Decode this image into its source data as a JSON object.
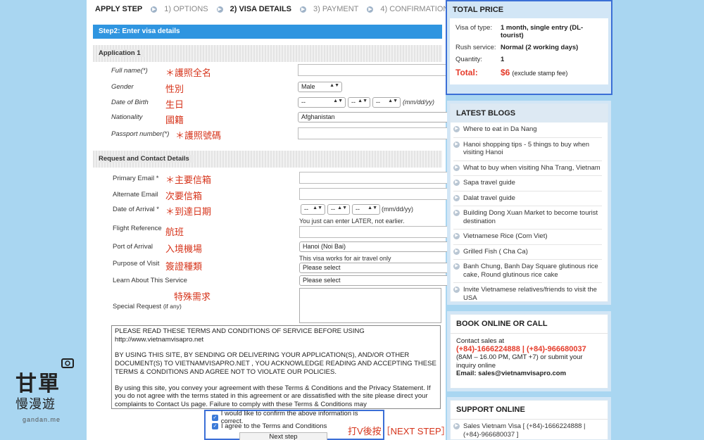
{
  "steps": {
    "label": "APPLY STEP",
    "s1": "1) OPTIONS",
    "s2": "2) VISA DETAILS",
    "s3": "3) PAYMENT",
    "s4": "4) CONFIRMATION"
  },
  "step_bar": "Step2: Enter visa details",
  "application": {
    "header": "Application 1",
    "full_name": "Full name(*)",
    "full_name_cn": "＊護照全名",
    "gender": "Gender",
    "gender_cn": "性別",
    "gender_value": "Male",
    "dob": "Date of Birth",
    "dob_cn": "生日",
    "dob_sel1": "--",
    "dob_sel2": "--",
    "dob_sel3": "--",
    "dob_hint": "(mm/dd/yy)",
    "nationality": "Nationality",
    "nationality_cn": "國籍",
    "nationality_value": "Afghanistan",
    "passport": "Passport number(*)",
    "passport_cn": "＊護照號碼"
  },
  "contact": {
    "header": "Request and Contact Details",
    "primary_email": "Primary Email *",
    "primary_email_cn": "＊主要信箱",
    "alt_email": "Alternate Email",
    "alt_email_cn": "次要信箱",
    "arrival": "Date of Arrival *",
    "arrival_cn": "＊到達日期",
    "arr_sel1": "--",
    "arr_sel2": "--",
    "arr_sel3": "--",
    "arrival_hint": "(mm/dd/yy)",
    "flight_note": "You just can enter LATER, not earlier.",
    "flight": "Flight Reference",
    "flight_cn": "航班",
    "port": "Port of Arrival",
    "port_cn": "入境機場",
    "port_value": "Hanoi (Noi Bai)",
    "port_note": "This visa works for air travel only",
    "purpose": "Purpose of Visit",
    "purpose_cn": "簽證種類",
    "purpose_value": "Please select",
    "learn": "Learn About This Service",
    "learn_value": "Please select",
    "special_cn": "特殊需求",
    "special": "Special Request",
    "special_sub": "(if any)"
  },
  "terms": {
    "p1": "PLEASE READ THESE TERMS AND CONDITIONS OF SERVICE BEFORE USING http://www.vietnamvisapro.net",
    "p2": "BY USING THIS SITE, BY SENDING OR DELIVERING YOUR APPLICATION(S), AND/OR OTHER DOCUMENT(S) TO VIETNAMVISAPRO.NET , YOU ACKNOWLEDGE READING AND ACCEPTING THESE TERMS & CONDITIONS AND AGREE NOT TO VIOLATE OUR POLICIES.",
    "p3": "By using this site, you convey your agreement with these Terms & Conditions and the Privacy Statement. If you do not agree with the terms stated in this agreement or are dissatisfied with the site please direct your complaints to Contact Us page. Failure to comply with these Terms & Conditions may"
  },
  "confirm": {
    "check1": "I would like to confirm the above information is correct.",
    "check2": "I agree to the Terms and Conditions",
    "next": "Next step",
    "annotation": "打V後按［NEXT STEP］"
  },
  "price": {
    "title": "TOTAL PRICE",
    "visa_type_k": "Visa of type:",
    "visa_type_v": "1 month, single entry (DL-tourist)",
    "rush_k": "Rush service:",
    "rush_v": "Normal (2 working days)",
    "qty_k": "Quantity:",
    "qty_v": "1",
    "total_k": "Total:",
    "total_v": "$6",
    "total_note": "(exclude stamp fee)"
  },
  "blogs": {
    "title": "LATEST BLOGS",
    "items": [
      "Where to eat in Da Nang",
      "Hanoi shopping tips - 5 things to buy when visiting Hanoi",
      "What to buy when visiting Nha Trang, Vietnam",
      "Sapa travel guide",
      "Dalat travel guide",
      "Building Dong Xuan Market to become tourist destination",
      "Vietnamese Rice (Com Viet)",
      "Grilled Fish ( Cha Ca)",
      "Banh Chung, Banh Day Square glutinous rice cake, Round glutinous rice cake",
      "Invite Vietnamese relatives/friends to visit the USA"
    ]
  },
  "book": {
    "title": "BOOK ONLINE OR CALL",
    "contact": "Contact sales at",
    "phones": "(+84)-1666224888 | (+84)-966680037",
    "hours": "(8AM – 16.00 PM, GMT +7) or submit your inquiry online",
    "email_label": "Email:",
    "email": "sales@vietnamvisapro.com"
  },
  "support": {
    "title": "SUPPORT ONLINE",
    "item": "Sales Vietnam Visa [ (+84)-1666224888 | (+84)-966680037 ]"
  },
  "logo": {
    "line1": "甘單",
    "line2": "慢漫遊",
    "site": "gandan.me"
  },
  "colors": {
    "accent_blue": "#2f95e0",
    "annotation_red": "#d6341b",
    "price_red": "#e53b2a",
    "background": "#a9d6f1"
  }
}
